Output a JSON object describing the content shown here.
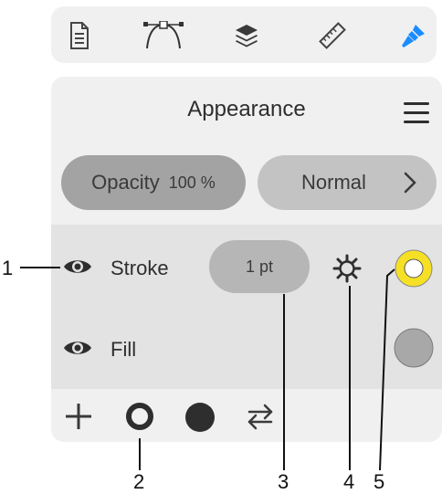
{
  "toolbar": {
    "tools": [
      {
        "icon": "document-icon"
      },
      {
        "icon": "pen-path-icon"
      },
      {
        "icon": "layers-icon"
      },
      {
        "icon": "ruler-icon"
      },
      {
        "icon": "brush-icon",
        "active": true
      }
    ],
    "active_color": "#1a8cff"
  },
  "panel": {
    "title": "Appearance",
    "opacity_label": "Opacity",
    "opacity_value": "100 %",
    "blend_mode": "Normal",
    "stroke": {
      "label": "Stroke",
      "weight": "1 pt",
      "color": "#f5e025"
    },
    "fill": {
      "label": "Fill",
      "color": "#a8a8a8"
    }
  },
  "callouts": {
    "one": "1",
    "two": "2",
    "three": "3",
    "four": "4",
    "five": "5"
  }
}
